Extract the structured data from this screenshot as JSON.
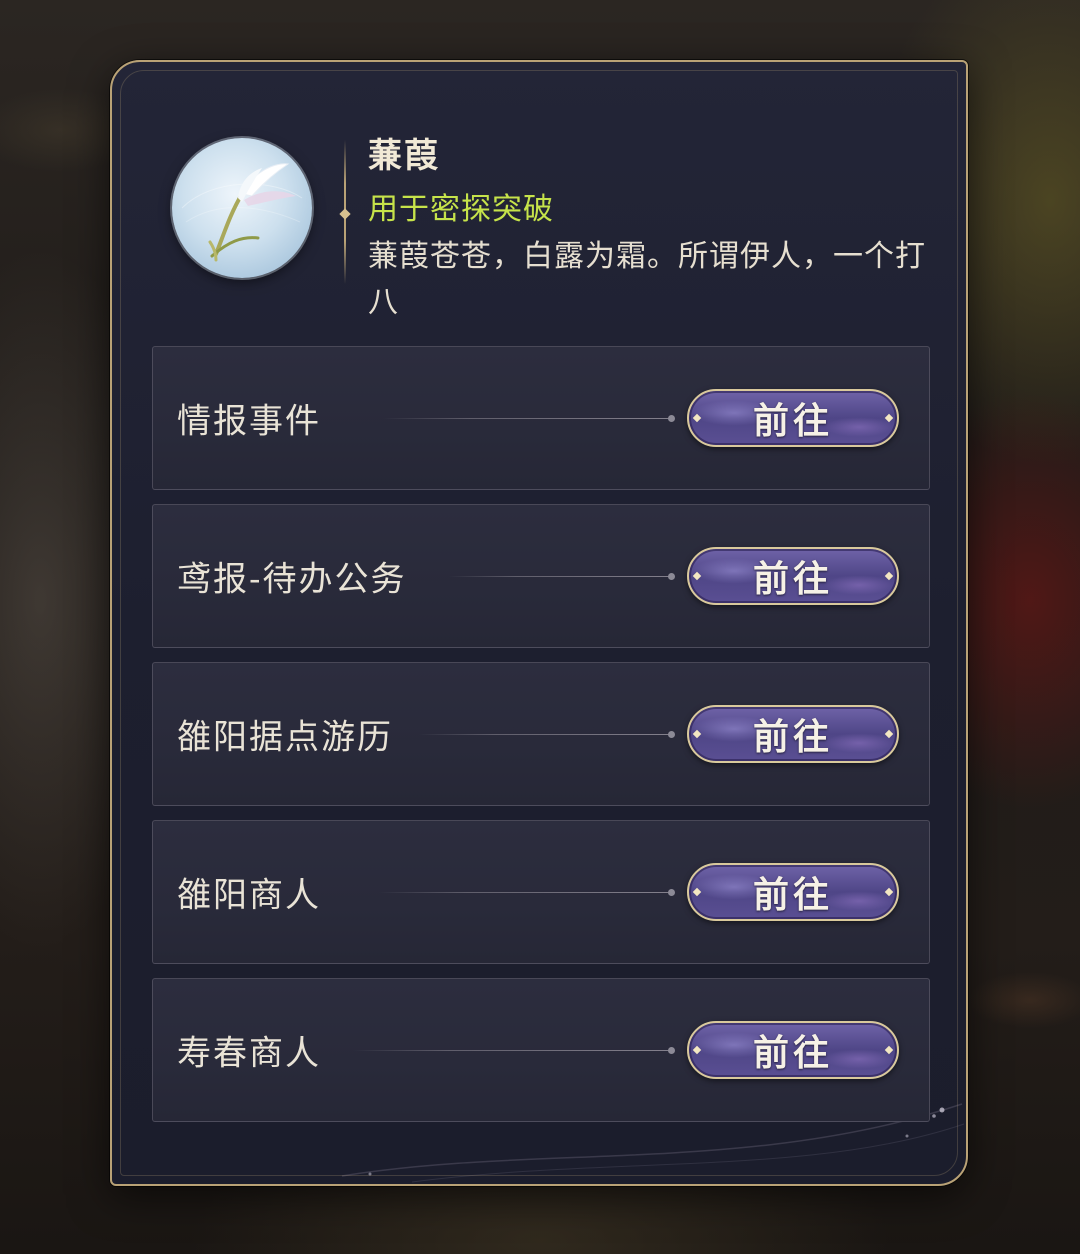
{
  "item": {
    "name": "蒹葭",
    "usage": "用于密探突破",
    "description": "蒹葭苍苍，白露为霜。所谓伊人，一个打八",
    "icon": "reed-feather-icon"
  },
  "sources": [
    {
      "label": "情报事件",
      "button_label": "前往"
    },
    {
      "label": "鸢报-待办公务",
      "button_label": "前往"
    },
    {
      "label": "雒阳据点游历",
      "button_label": "前往"
    },
    {
      "label": "雒阳商人",
      "button_label": "前往"
    },
    {
      "label": "寿春商人",
      "button_label": "前往"
    }
  ],
  "colors": {
    "panel_border": "#b9a276",
    "usage_text": "#c6e34a",
    "button_fill": "#5a4f93"
  }
}
